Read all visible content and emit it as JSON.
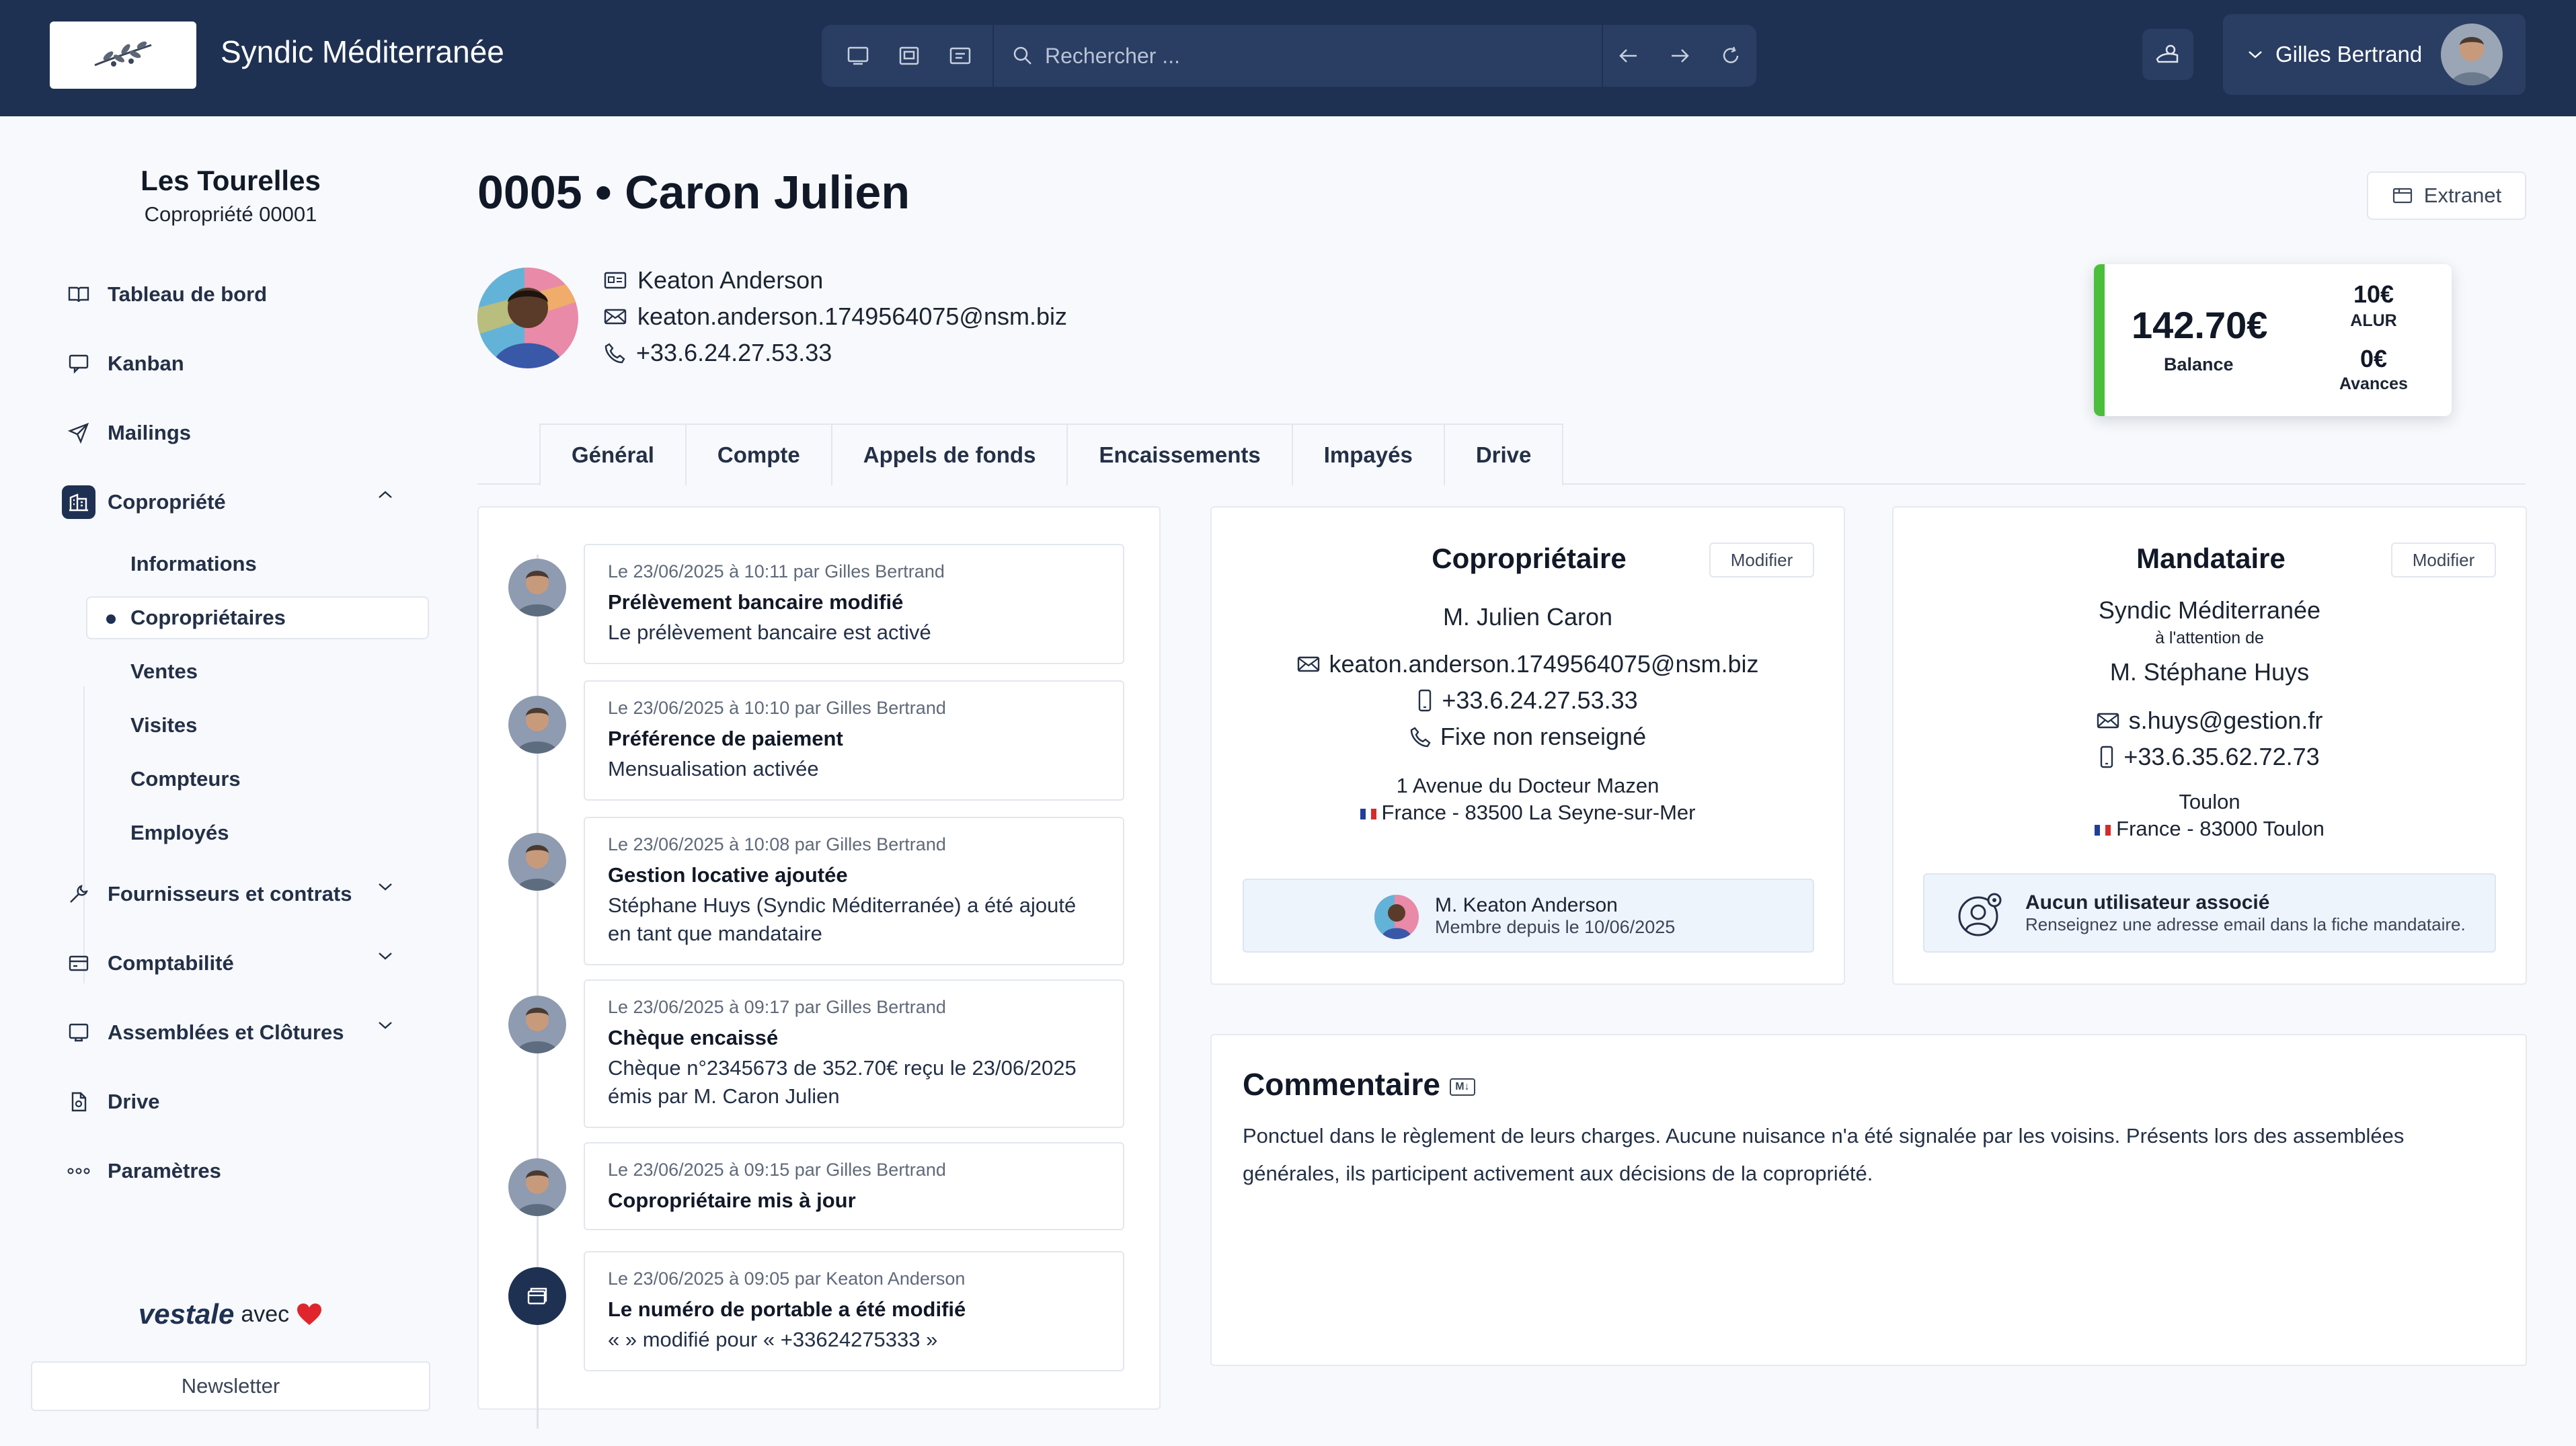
{
  "header": {
    "app_title": "Syndic Méditerranée",
    "search_placeholder": "Rechercher ...",
    "user_name": "Gilles Bertrand"
  },
  "sidebar": {
    "building_name": "Les Tourelles",
    "building_ref": "Copropriété 00001",
    "items": [
      {
        "label": "Tableau de bord",
        "icon": "book-icon"
      },
      {
        "label": "Kanban",
        "icon": "kanban-icon"
      },
      {
        "label": "Mailings",
        "icon": "send-icon"
      },
      {
        "label": "Copropriété",
        "icon": "building-icon"
      },
      {
        "label": "Fournisseurs et contrats",
        "icon": "wrench-icon"
      },
      {
        "label": "Comptabilité",
        "icon": "wallet-icon"
      },
      {
        "label": "Assemblées et Clôtures",
        "icon": "meeting-icon"
      },
      {
        "label": "Drive",
        "icon": "files-icon"
      },
      {
        "label": "Paramètres",
        "icon": "dots-icon"
      }
    ],
    "sub_items": [
      "Informations",
      "Copropriétaires",
      "Ventes",
      "Visites",
      "Compteurs",
      "Employés"
    ],
    "brand_name": "vestale",
    "brand_suffix": "avec",
    "newsletter_label": "Newsletter"
  },
  "page": {
    "title": "0005 • Caron Julien",
    "extranet_label": "Extranet",
    "contact": {
      "name": "Keaton Anderson",
      "email": "keaton.anderson.1749564075@nsm.biz",
      "phone": "+33.6.24.27.53.33"
    },
    "balance": {
      "amount": "142.70€",
      "label": "Balance",
      "alur_amount": "10€",
      "alur_label": "ALUR",
      "avances_amount": "0€",
      "avances_label": "Avances",
      "accent_color": "#4bbf3c"
    },
    "tabs": [
      "Général",
      "Compte",
      "Appels de fonds",
      "Encaissements",
      "Impayés",
      "Drive"
    ],
    "active_tab": "Général"
  },
  "timeline": [
    {
      "meta": "Le 23/06/2025 à 10:11 par Gilles Bertrand",
      "title": "Prélèvement bancaire modifié",
      "body": "Le prélèvement bancaire est activé"
    },
    {
      "meta": "Le 23/06/2025 à 10:10 par Gilles Bertrand",
      "title": "Préférence de paiement",
      "body": "Mensualisation activée"
    },
    {
      "meta": "Le 23/06/2025 à 10:08 par Gilles Bertrand",
      "title": "Gestion locative ajoutée",
      "body": "Stéphane Huys (Syndic Méditerranée) a été ajouté en tant que mandataire"
    },
    {
      "meta": "Le 23/06/2025 à 09:17 par Gilles Bertrand",
      "title": "Chèque encaissé",
      "body": "Chèque n°2345673 de 352.70€ reçu le 23/06/2025 émis par M. Caron Julien"
    },
    {
      "meta": "Le 23/06/2025 à 09:15 par Gilles Bertrand",
      "title": "Copropriétaire mis à jour",
      "body": ""
    },
    {
      "meta": "Le 23/06/2025 à 09:05 par Keaton Anderson",
      "title": "Le numéro de portable a été modifié",
      "body": "« » modifié pour « +33624275333 »"
    }
  ],
  "coproprietaire": {
    "title": "Copropriétaire",
    "modify_label": "Modifier",
    "name": "M. Julien Caron",
    "email": "keaton.anderson.1749564075@nsm.biz",
    "mobile": "+33.6.24.27.53.33",
    "landline": "Fixe non renseigné",
    "address_line": "1 Avenue du Docteur Mazen",
    "city_line": "France - 83500 La Seyne-sur-Mer",
    "member_name": "M. Keaton Anderson",
    "member_since": "Membre depuis le 10/06/2025"
  },
  "mandataire": {
    "title": "Mandataire",
    "modify_label": "Modifier",
    "company": "Syndic Méditerranée",
    "attention": "à l'attention de",
    "name": "M. Stéphane Huys",
    "email": "s.huys@gestion.fr",
    "mobile": "+33.6.35.62.72.73",
    "city": "Toulon",
    "city_line": "France - 83000 Toulon",
    "no_user_title": "Aucun utilisateur associé",
    "no_user_body": "Renseignez une adresse email dans la fiche mandataire."
  },
  "commentaire": {
    "title": "Commentaire",
    "badge": "M↓",
    "text": "Ponctuel dans le règlement de leurs charges. Aucune nuisance n'a été signalée par les voisins. Présents lors des assemblées générales, ils participent activement aux décisions de la copropriété."
  }
}
